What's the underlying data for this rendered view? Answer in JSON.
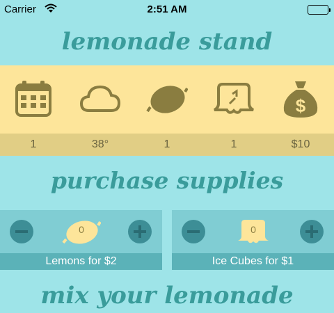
{
  "status_bar": {
    "carrier": "Carrier",
    "time": "2:51 AM"
  },
  "titles": {
    "main": "lemonade stand",
    "purchase": "purchase supplies",
    "mix": "mix your lemonade"
  },
  "stats": [
    {
      "icon": "calendar-icon",
      "value": "1"
    },
    {
      "icon": "cloud-icon",
      "value": "38°"
    },
    {
      "icon": "lemon-icon",
      "value": "1"
    },
    {
      "icon": "ice-cube-icon",
      "value": "1"
    },
    {
      "icon": "money-bag-icon",
      "value": "$10"
    }
  ],
  "supplies": {
    "lemons": {
      "label": "Lemons for $2",
      "quantity": "0"
    },
    "ice": {
      "label": "Ice Cubes for $1",
      "quantity": "0"
    }
  },
  "colors": {
    "background": "#9ee4e8",
    "stats_band": "#fde59a",
    "stats_values_band": "#e1ce85",
    "icon_olive": "#8a7d40",
    "title_teal": "#3a9c9b",
    "card": "#80cdd3",
    "card_label": "#5bb2b8",
    "button": "#3d8e96"
  }
}
